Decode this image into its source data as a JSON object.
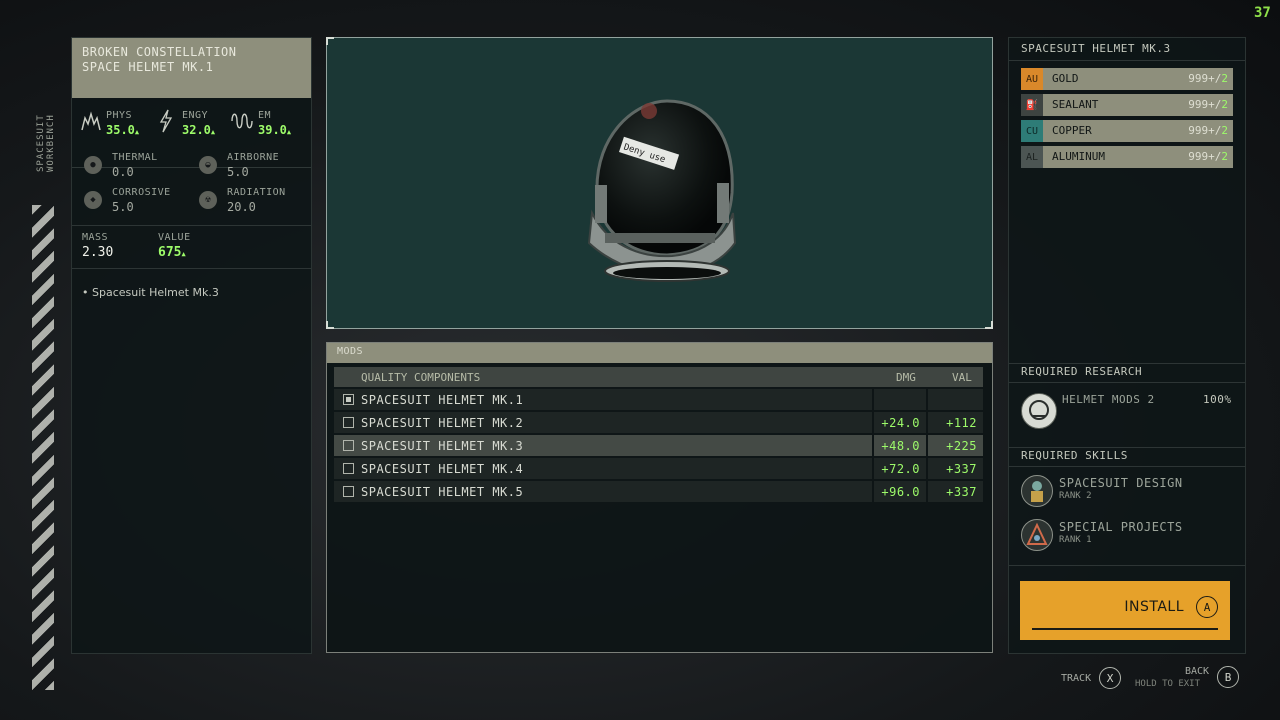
{
  "fps": "37",
  "side_label": "SPACESUIT WORKBENCH",
  "item": {
    "line1": "BROKEN CONSTELLATION",
    "line2": "SPACE HELMET MK.1"
  },
  "damage": {
    "phys": {
      "label": "PHYS",
      "value": "35.0",
      "arrow": "▲"
    },
    "engy": {
      "label": "ENGY",
      "value": "32.0",
      "arrow": "▲"
    },
    "em": {
      "label": "EM",
      "value": "39.0",
      "arrow": "▲"
    }
  },
  "resistances": {
    "thermal": {
      "label": "THERMAL",
      "value": "0.0"
    },
    "airborne": {
      "label": "AIRBORNE",
      "value": "5.0"
    },
    "corrosive": {
      "label": "CORROSIVE",
      "value": "5.0"
    },
    "radiation": {
      "label": "RADIATION",
      "value": "20.0"
    }
  },
  "mass": {
    "label": "MASS",
    "value": "2.30"
  },
  "value": {
    "label": "VALUE",
    "value": "675",
    "arrow": "▲"
  },
  "note": "• Spacesuit Helmet Mk.3",
  "preview": {
    "sticker": "Deny use"
  },
  "mods": {
    "title": "MODS",
    "col_name": "QUALITY COMPONENTS",
    "col_dmg": "DMG",
    "col_val": "VAL",
    "rows": [
      {
        "name": "SPACESUIT HELMET MK.1",
        "dmg": "",
        "val": "",
        "checked": true
      },
      {
        "name": "SPACESUIT HELMET MK.2",
        "dmg": "+24.0",
        "val": "+112",
        "checked": false
      },
      {
        "name": "SPACESUIT HELMET MK.3",
        "dmg": "+48.0",
        "val": "+225",
        "checked": false,
        "selected": true
      },
      {
        "name": "SPACESUIT HELMET MK.4",
        "dmg": "+72.0",
        "val": "+337",
        "checked": false
      },
      {
        "name": "SPACESUIT HELMET MK.5",
        "dmg": "+96.0",
        "val": "+337",
        "checked": false
      }
    ]
  },
  "recipe": {
    "title": "SPACESUIT HELMET MK.3",
    "resources": [
      {
        "symbol": "AU",
        "name": "GOLD",
        "have": "999+/",
        "need": "2",
        "color": "#d9882a"
      },
      {
        "symbol": "",
        "name": "SEALANT",
        "have": "999+/",
        "need": "2",
        "color": "#3e4441"
      },
      {
        "symbol": "CU",
        "name": "COPPER",
        "have": "999+/",
        "need": "2",
        "color": "#2e7c77"
      },
      {
        "symbol": "AL",
        "name": "ALUMINUM",
        "have": "999+/",
        "need": "2",
        "color": "#4c5553"
      }
    ]
  },
  "research": {
    "title": "REQUIRED RESEARCH",
    "name": "HELMET MODS 2",
    "percent": "100%"
  },
  "skills": {
    "title": "REQUIRED SKILLS",
    "items": [
      {
        "name": "SPACESUIT DESIGN",
        "rank": "RANK 2"
      },
      {
        "name": "SPECIAL PROJECTS",
        "rank": "RANK 1"
      }
    ]
  },
  "install": {
    "label": "INSTALL",
    "button": "A"
  },
  "hints": {
    "track_label": "TRACK",
    "track_button": "X",
    "back_label": "BACK",
    "back_sub": "HOLD TO EXIT",
    "back_button": "B"
  },
  "colors": {
    "accent_green": "#9dfb6a",
    "install_orange": "#e6a12a",
    "header_khaki": "#8e8f7c"
  }
}
